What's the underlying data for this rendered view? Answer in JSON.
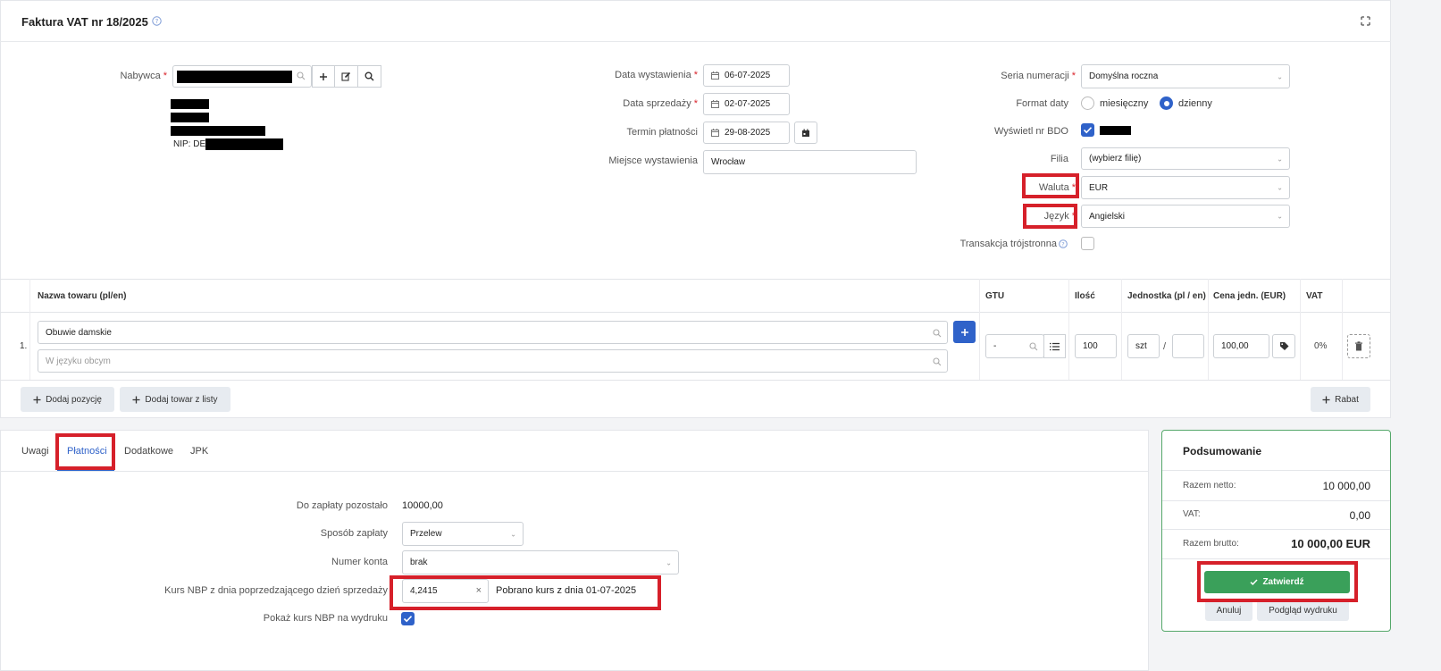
{
  "header": {
    "title": "Faktura VAT nr 18/2025"
  },
  "buyer": {
    "label": "Nabywca",
    "nip_prefix": "NIP: DE"
  },
  "dates": {
    "issue_label": "Data wystawienia",
    "issue_value": "06-07-2025",
    "sale_label": "Data sprzedaży",
    "sale_value": "02-07-2025",
    "due_label": "Termin płatności",
    "due_value": "29-08-2025",
    "place_label": "Miejsce wystawienia",
    "place_value": "Wrocław"
  },
  "settings": {
    "series_label": "Seria numeracji",
    "series_value": "Domyślna roczna",
    "date_format_label": "Format daty",
    "opt_monthly": "miesięczny",
    "opt_daily": "dzienny",
    "bdo_label": "Wyświetl nr BDO",
    "branch_label": "Filia",
    "branch_value": "(wybierz filię)",
    "currency_label": "Waluta",
    "currency_value": "EUR",
    "language_label": "Język",
    "language_value": "Angielski",
    "triangular_label": "Transakcja trójstronna"
  },
  "items": {
    "headers": {
      "name": "Nazwa towaru (pl/en)",
      "gtu": "GTU",
      "qty": "Ilość",
      "unit": "Jednostka (pl / en)",
      "price": "Cena jedn. (EUR)",
      "vat": "VAT"
    },
    "row": {
      "index": "1.",
      "name": "Obuwie damskie",
      "foreign_placeholder": "W języku obcym",
      "gtu": "-",
      "qty": "100",
      "unit": "szt",
      "unit_sep": "/",
      "price": "100,00",
      "vat": "0%"
    },
    "add_position": "Dodaj pozycję",
    "add_from_list": "Dodaj towar z listy",
    "discount": "Rabat"
  },
  "tabs": [
    "Uwagi",
    "Płatności",
    "Dodatkowe",
    "JPK"
  ],
  "payments": {
    "remaining_label": "Do zapłaty pozostało",
    "remaining_value": "10000,00",
    "method_label": "Sposób zapłaty",
    "method_value": "Przelew",
    "account_label": "Numer konta",
    "account_value": "brak",
    "rate_label": "Kurs NBP z dnia poprzedzającego dzień sprzedaży",
    "rate_value": "4,2415",
    "rate_note": "Pobrano kurs z dnia 01-07-2025",
    "show_rate_label": "Pokaż kurs NBP na wydruku"
  },
  "summary": {
    "title": "Podsumowanie",
    "net_label": "Razem netto:",
    "net_value": "10 000,00",
    "vat_label": "VAT:",
    "vat_value": "0,00",
    "gross_label": "Razem brutto:",
    "gross_value": "10 000,00 EUR",
    "confirm": "Zatwierdź",
    "cancel": "Anuluj",
    "preview": "Podgląd wydruku"
  },
  "colors": {
    "primary": "#2f62c9",
    "success": "#3aa05a",
    "highlight": "#d6202a"
  }
}
